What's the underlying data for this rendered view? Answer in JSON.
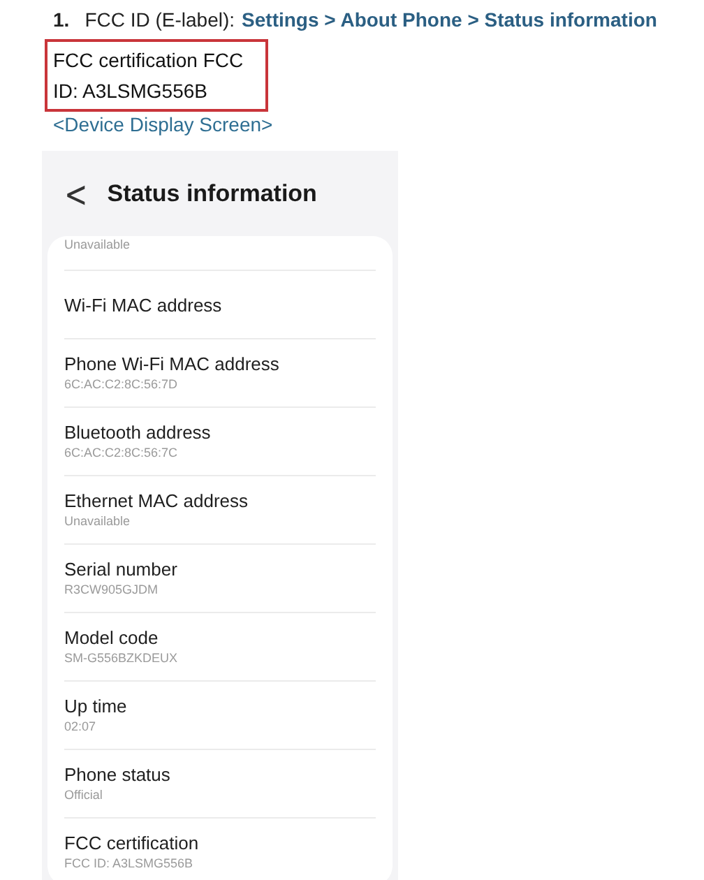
{
  "instruction": {
    "number": "1.",
    "label": "FCC ID (E-label):",
    "path": "Settings > About Phone > Status information"
  },
  "highlight_box": {
    "lines": [
      "FCC certification FCC",
      "ID: A3LSMG556B"
    ]
  },
  "caption": "<Device Display Screen>",
  "phone_screen": {
    "title": "Status information",
    "back_icon": "<",
    "items": [
      {
        "value": "Unavailable"
      },
      {
        "title": "Wi-Fi MAC address"
      },
      {
        "title": "Phone Wi-Fi MAC address",
        "value": "6C:AC:C2:8C:56:7D"
      },
      {
        "title": "Bluetooth address",
        "value": "6C:AC:C2:8C:56:7C"
      },
      {
        "title": "Ethernet MAC address",
        "value": "Unavailable"
      },
      {
        "title": "Serial number",
        "value": "R3CW905GJDM"
      },
      {
        "title": "Model code",
        "value": "SM-G556BZKDEUX"
      },
      {
        "title": "Up time",
        "value": "02:07"
      },
      {
        "title": "Phone status",
        "value": "Official"
      },
      {
        "title": "FCC certification",
        "value": "FCC ID: A3LSMG556B"
      }
    ]
  }
}
